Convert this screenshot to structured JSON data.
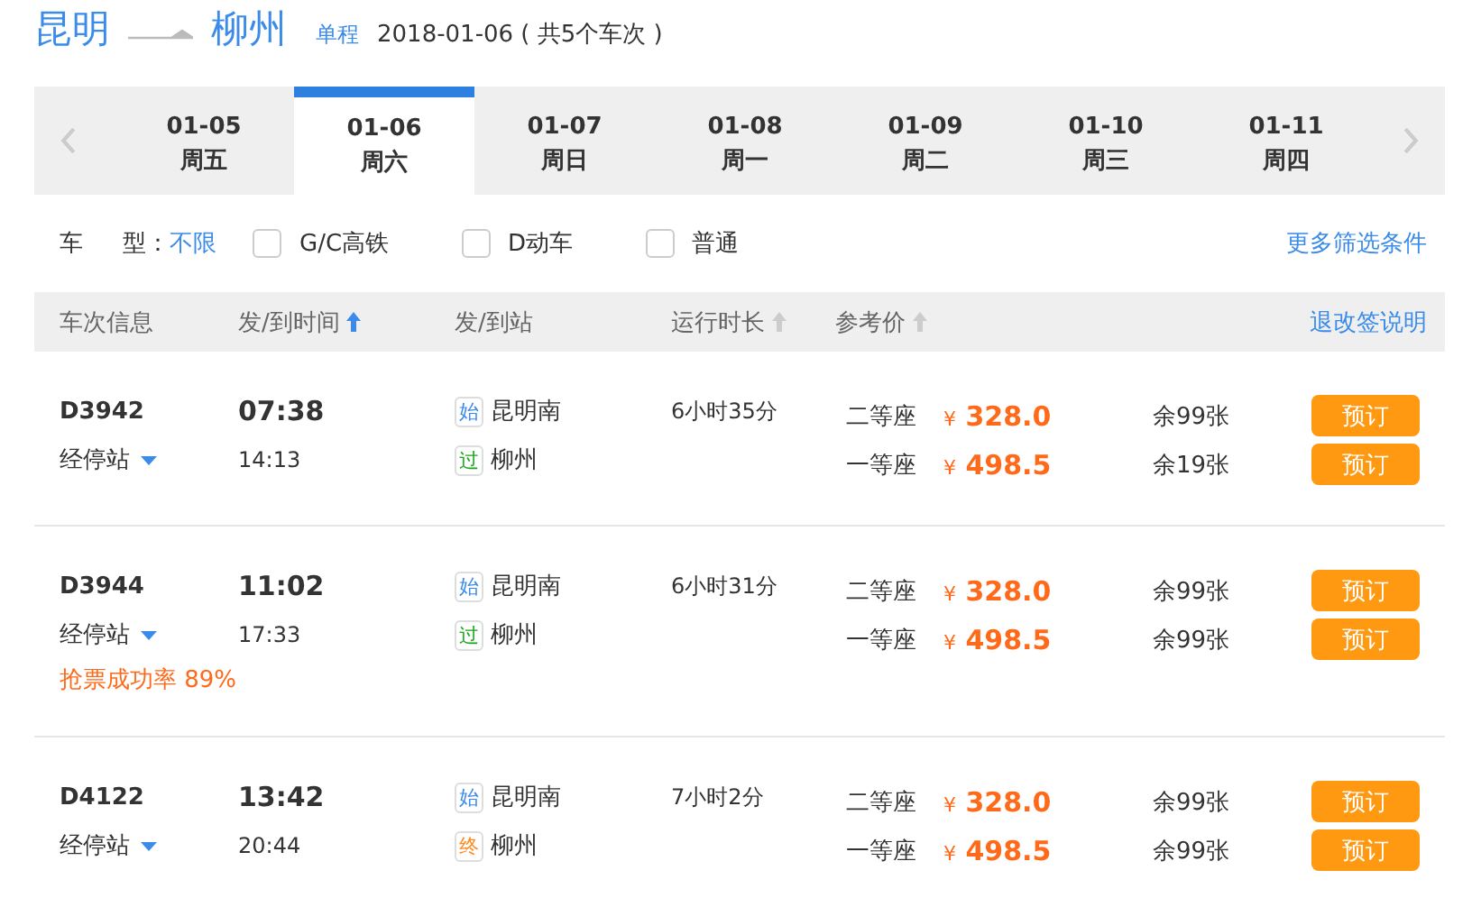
{
  "route": {
    "from": "昆明",
    "to": "柳州",
    "trip_type": "单程",
    "summary": "2018-01-06 ( 共5个车次 )"
  },
  "date_tabs": [
    {
      "date": "01-05",
      "weekday": "周五",
      "selected": false
    },
    {
      "date": "01-06",
      "weekday": "周六",
      "selected": true
    },
    {
      "date": "01-07",
      "weekday": "周日",
      "selected": false
    },
    {
      "date": "01-08",
      "weekday": "周一",
      "selected": false
    },
    {
      "date": "01-09",
      "weekday": "周二",
      "selected": false
    },
    {
      "date": "01-10",
      "weekday": "周三",
      "selected": false
    },
    {
      "date": "01-11",
      "weekday": "周四",
      "selected": false
    }
  ],
  "filter": {
    "label_1": "车",
    "label_2": "型：",
    "value": "不限",
    "options": [
      {
        "label": "G/C高铁",
        "checked": false
      },
      {
        "label": "D动车",
        "checked": false
      },
      {
        "label": "普通",
        "checked": false
      }
    ],
    "more": "更多筛选条件"
  },
  "columns": [
    {
      "label": "车次信息"
    },
    {
      "label": "发/到时间",
      "sorted": true
    },
    {
      "label": "发/到站"
    },
    {
      "label": "运行时长",
      "sorted": false
    },
    {
      "label": "参考价",
      "sorted": false
    }
  ],
  "refund_link": "退改签说明",
  "trains": [
    {
      "number": "D3942",
      "stops_label": "经停站",
      "depart": "07:38",
      "arrive": "14:13",
      "from_tag": {
        "text": "始",
        "kind": "start"
      },
      "from": "昆明南",
      "to_tag": {
        "text": "过",
        "kind": "pass"
      },
      "to": "柳州",
      "duration": "6小时35分",
      "seats": [
        {
          "name": "二等座",
          "currency": "¥",
          "price": "328.0",
          "remain": "余99张",
          "action": "预订"
        },
        {
          "name": "一等座",
          "currency": "¥",
          "price": "498.5",
          "remain": "余19张",
          "action": "预订"
        }
      ]
    },
    {
      "number": "D3944",
      "stops_label": "经停站",
      "depart": "11:02",
      "arrive": "17:33",
      "from_tag": {
        "text": "始",
        "kind": "start"
      },
      "from": "昆明南",
      "to_tag": {
        "text": "过",
        "kind": "pass"
      },
      "to": "柳州",
      "duration": "6小时31分",
      "note": "抢票成功率 89%",
      "seats": [
        {
          "name": "二等座",
          "currency": "¥",
          "price": "328.0",
          "remain": "余99张",
          "action": "预订"
        },
        {
          "name": "一等座",
          "currency": "¥",
          "price": "498.5",
          "remain": "余99张",
          "action": "预订"
        }
      ]
    },
    {
      "number": "D4122",
      "stops_label": "经停站",
      "depart": "13:42",
      "arrive": "20:44",
      "from_tag": {
        "text": "始",
        "kind": "start"
      },
      "from": "昆明南",
      "to_tag": {
        "text": "终",
        "kind": "end"
      },
      "to": "柳州",
      "duration": "7小时2分",
      "seats": [
        {
          "name": "二等座",
          "currency": "¥",
          "price": "328.0",
          "remain": "余99张",
          "action": "预订"
        },
        {
          "name": "一等座",
          "currency": "¥",
          "price": "498.5",
          "remain": "余99张",
          "action": "预订"
        }
      ]
    }
  ]
}
